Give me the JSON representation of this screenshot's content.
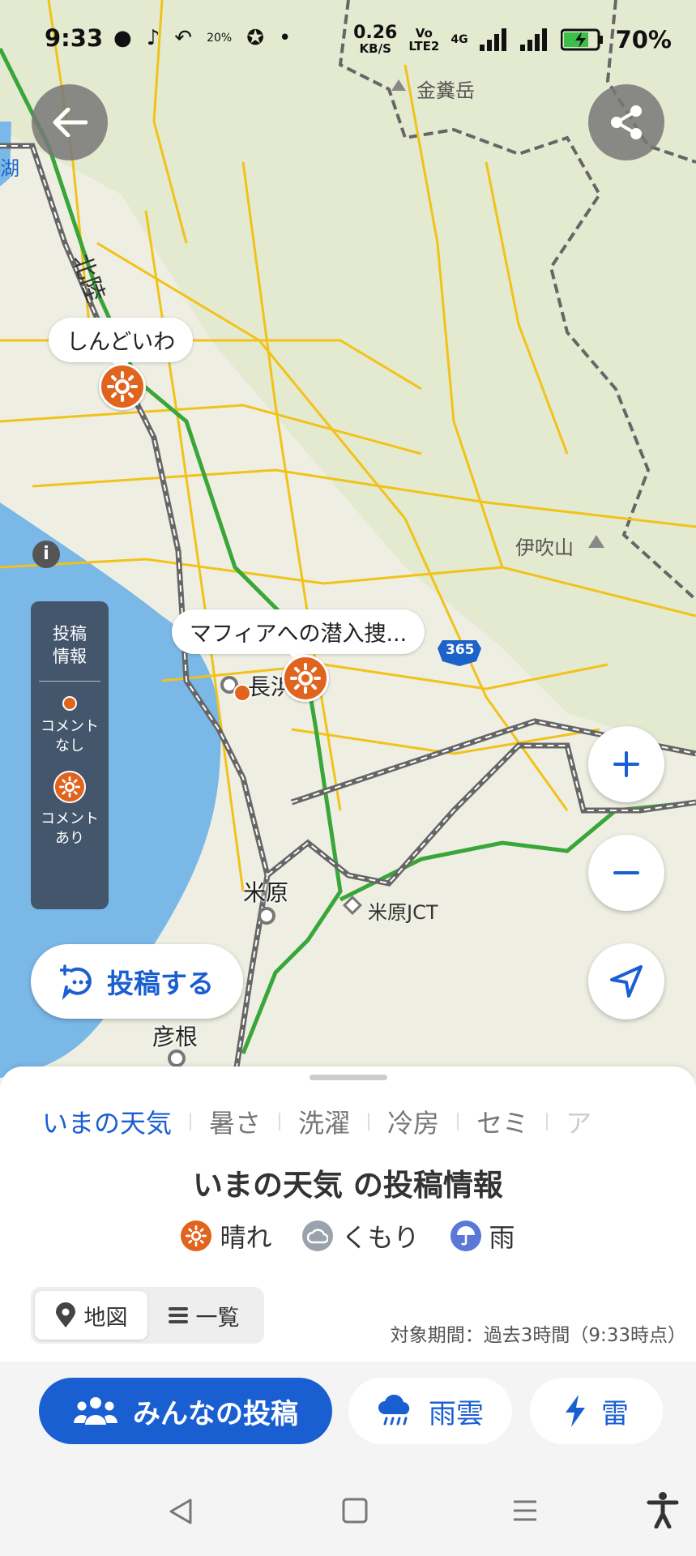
{
  "status_bar": {
    "time": "9:33",
    "weather_badge": "20%",
    "speed_value": "0.26",
    "speed_unit": "KB/S",
    "volte_top": "Vo",
    "volte_bottom": "LTE2",
    "network": "4G",
    "battery": "70%"
  },
  "map": {
    "labels": {
      "kinkasan": "金糞岳",
      "lake_edge": "湖",
      "hokuriku": "北陸",
      "ibukiyama": "伊吹山",
      "nagahama": "長浜",
      "maibara": "米原",
      "maibara_jct": "米原JCT",
      "hikone": "彦根",
      "route": "365"
    },
    "callouts": {
      "shindoiwa": "しんどいわ",
      "mafia": "マフィアへの潜入捜..."
    },
    "legend_panel": {
      "title": "投稿\n情報",
      "no_comment": "コメント\nなし",
      "with_comment": "コメント\nあり"
    },
    "post_button": "投稿する"
  },
  "sheet": {
    "tabs": [
      "いまの天気",
      "暑さ",
      "洗濯",
      "冷房",
      "セミ",
      "ア"
    ],
    "active_tab": 0,
    "title": "いまの天気 の投稿情報",
    "legend": [
      "晴れ",
      "くもり",
      "雨"
    ],
    "view_toggle": [
      "地図",
      "一覧"
    ],
    "period": "対象期間：過去3時間（9:33時点）"
  },
  "bottom_buttons": {
    "everyone": "みんなの投稿",
    "rain_cloud": "雨雲",
    "thunder": "雷"
  },
  "colors": {
    "accent": "#1a5fd1",
    "sunny": "#e0641e",
    "lake": "#7ab8e8"
  }
}
